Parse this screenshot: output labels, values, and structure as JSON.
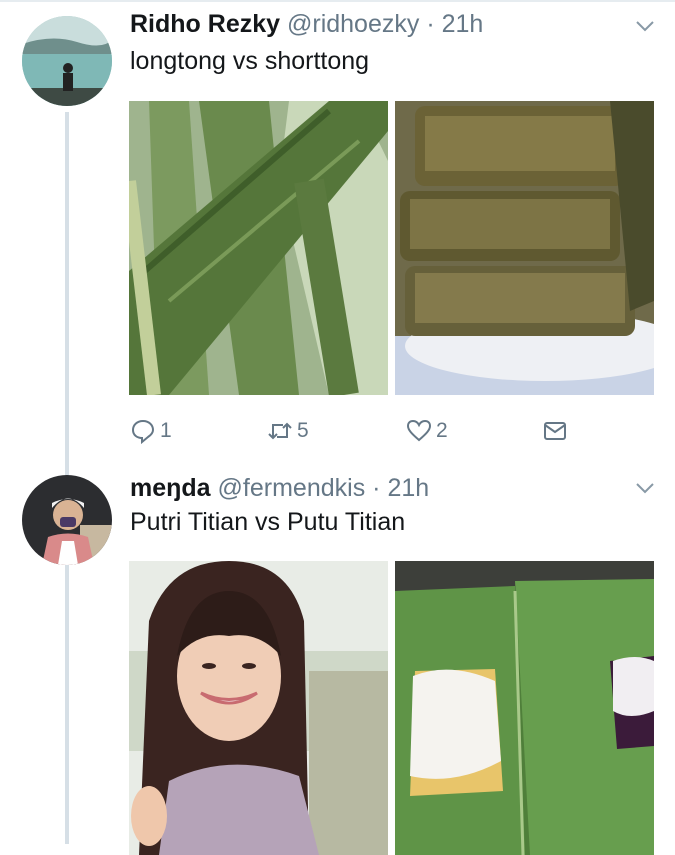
{
  "tweets": [
    {
      "name": "Ridho Rezky",
      "handle": "@ridhoezky",
      "separator": "·",
      "time": "21h",
      "text": "longtong vs shorttong",
      "media_left": "long green bamboo-wrapped lontong",
      "media_right": "short leaf-wrapped rice rolls on a plate",
      "actions": {
        "reply_count": "1",
        "retweet_count": "5",
        "like_count": "2"
      }
    },
    {
      "name": "meŋda",
      "handle": "@fermendkis",
      "separator": "·",
      "time": "21h",
      "text": "Putri Titian vs Putu Titian",
      "media_left": "smiling woman with long dark hair",
      "media_right": "putu cakes with grated coconut on banana leaf"
    }
  ],
  "icons": {
    "reply": "reply-icon",
    "retweet": "retweet-icon",
    "like": "heart-icon",
    "dm": "envelope-icon",
    "more": "chevron-down-icon"
  },
  "colors": {
    "text_primary": "#14171a",
    "text_secondary": "#657786",
    "thread_line": "#d6dfe6"
  }
}
